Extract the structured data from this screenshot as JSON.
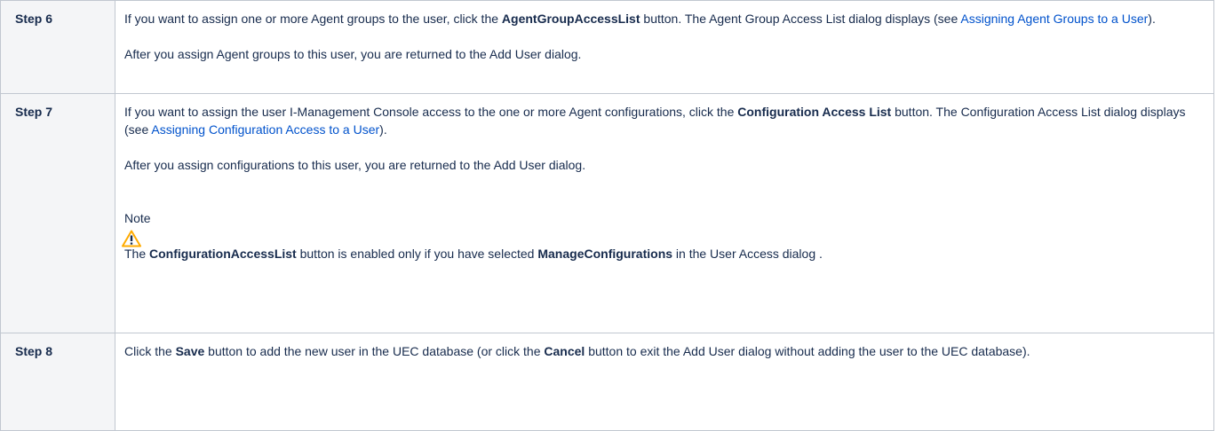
{
  "rows": [
    {
      "step": "Step 6",
      "p1_a": "If you want to assign one or more Agent groups to the user, click the ",
      "p1_b": "AgentGroupAccessList",
      "p1_c": " button. The Agent Group Access List dialog displays (see ",
      "p1_link": "Assigning Agent Groups to a User",
      "p1_d": ").",
      "p2": "After you assign Agent groups to this user, you are returned to the Add User dialog."
    },
    {
      "step": "Step 7",
      "p1_a": "If you want to assign the user I-Management Console access to the one or more Agent configurations, click the ",
      "p1_b": "Configuration Access List",
      "p1_c": " button. The Configuration Access List dialog displays (see ",
      "p1_link": "Assigning Configuration Access to a User",
      "p1_d": ").",
      "p2": "After you assign configurations to this user, you are returned to the Add User dialog.",
      "note_title": "Note",
      "note_a": "The ",
      "note_b": "ConfigurationAccessList",
      "note_c": " button is enabled only if you have selected ",
      "note_d": "ManageConfigurations",
      "note_e": " in the User Access dialog ."
    },
    {
      "step": "Step 8",
      "p1_a": "Click the ",
      "p1_b": "Save",
      "p1_c": " button to add the new user in the UEC database (or click the ",
      "p1_d": "Cancel",
      "p1_e": " button to exit the Add User dialog without adding the user to the UEC database)."
    }
  ],
  "colors": {
    "link": "#0052cc",
    "header_bg": "#f4f5f7",
    "border": "#c1c7d0",
    "warning": "#ffab00"
  },
  "icons": {
    "note": "warning-icon"
  }
}
